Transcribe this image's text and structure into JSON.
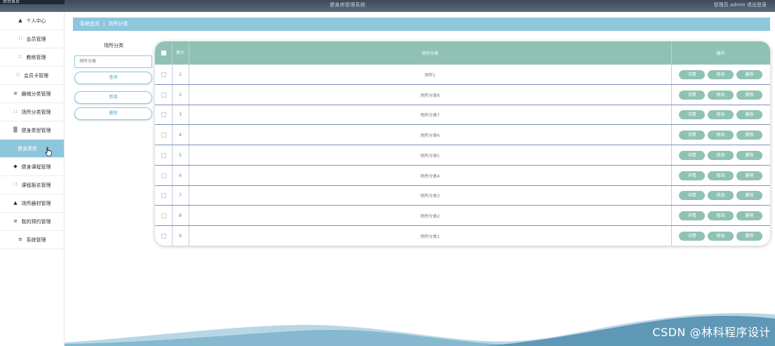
{
  "topbar": {
    "corner_text": "后台首页",
    "title": "健身房管理系统",
    "right_text": "管理员 admin  退出登录"
  },
  "sidebar": {
    "items": [
      {
        "label": "个人中心",
        "icon": "user-icon"
      },
      {
        "label": "会员管理",
        "icon": "grid-icon"
      },
      {
        "label": "教练管理",
        "icon": "grid-icon"
      },
      {
        "label": "会员卡管理",
        "icon": "grid-icon"
      },
      {
        "label": "器械分类管理",
        "icon": "sliders-icon"
      },
      {
        "label": "场所分类管理",
        "icon": "grid-icon"
      },
      {
        "label": "健身类型管理",
        "icon": "table-icon"
      },
      {
        "label": "健身类型",
        "icon": "none",
        "active": true
      },
      {
        "label": "健身课程管理",
        "icon": "drop-icon"
      },
      {
        "label": "课程报名管理",
        "icon": "grid-icon"
      },
      {
        "label": "场所器材管理",
        "icon": "user-icon"
      },
      {
        "label": "我的预约管理",
        "icon": "list-icon"
      },
      {
        "label": "系统管理",
        "icon": "list-icon"
      }
    ]
  },
  "breadcrumb": {
    "home": "系统首页",
    "separator": "|",
    "current": "场所分类"
  },
  "search": {
    "label": "场所分类",
    "placeholder": "场所分类",
    "query_button": "查询",
    "add_button": "新增",
    "delete_button": "删除"
  },
  "table": {
    "headers": {
      "index": "索引",
      "name": "场所分类",
      "actions": "操作"
    },
    "action_labels": {
      "detail": "详情",
      "edit": "修改",
      "delete": "删除"
    },
    "rows": [
      {
        "index": "1",
        "name": "场所1"
      },
      {
        "index": "2",
        "name": "场所分类8"
      },
      {
        "index": "3",
        "name": "场所分类7"
      },
      {
        "index": "4",
        "name": "场所分类6"
      },
      {
        "index": "5",
        "name": "场所分类5"
      },
      {
        "index": "6",
        "name": "场所分类4"
      },
      {
        "index": "7",
        "name": "场所分类3"
      },
      {
        "index": "8",
        "name": "场所分类2"
      },
      {
        "index": "9",
        "name": "场所分类1"
      }
    ]
  },
  "watermark": "CSDN @林科程序设计",
  "colors": {
    "accent": "#8ec6dc",
    "table_header": "#8fc2b4",
    "topbar": "#4a5868"
  }
}
